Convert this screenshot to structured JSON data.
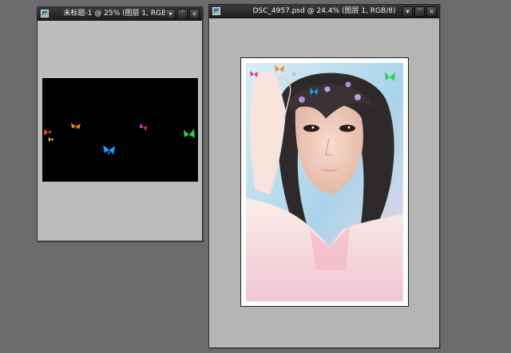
{
  "windows": {
    "untitled": {
      "title": "未标题-1 @ 25% (图层 1, RGB/8)",
      "buttons": {
        "menu": "▾",
        "minimize": "ˆ",
        "close": "×"
      }
    },
    "photo_doc": {
      "title": "DSC_4957.psd @ 24.4% (图层 1, RGB/8)",
      "buttons": {
        "menu": "▾",
        "minimize": "ˆ",
        "close": "×"
      }
    }
  },
  "colors": {
    "workspace": "#6b6b6b",
    "canvas_gray": "#bdbdbd",
    "butterflies": [
      "#ff3b3b",
      "#ffd23b",
      "#ff8a1e",
      "#ff2ad0",
      "#2fd24b",
      "#1ea0ff"
    ]
  }
}
